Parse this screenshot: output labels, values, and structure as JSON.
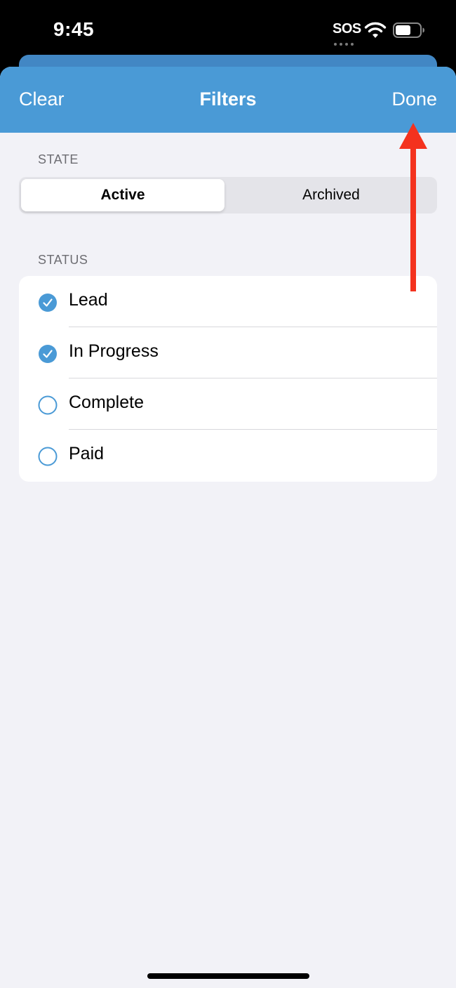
{
  "status_bar": {
    "time": "9:45",
    "sos": "SOS",
    "wifi_icon": "wifi-icon",
    "battery_icon": "battery-icon"
  },
  "nav": {
    "clear_label": "Clear",
    "title": "Filters",
    "done_label": "Done",
    "background_color": "#4a9ad6"
  },
  "state_section": {
    "header": "STATE",
    "segments": [
      {
        "label": "Active",
        "selected": true
      },
      {
        "label": "Archived",
        "selected": false
      }
    ]
  },
  "status_section": {
    "header": "STATUS",
    "items": [
      {
        "label": "Lead",
        "checked": true
      },
      {
        "label": "In Progress",
        "checked": true
      },
      {
        "label": "Complete",
        "checked": false
      },
      {
        "label": "Paid",
        "checked": false
      }
    ]
  },
  "colors": {
    "accent": "#4a9ad6",
    "annotation_arrow": "#f4321e",
    "background": "#f2f2f7"
  }
}
